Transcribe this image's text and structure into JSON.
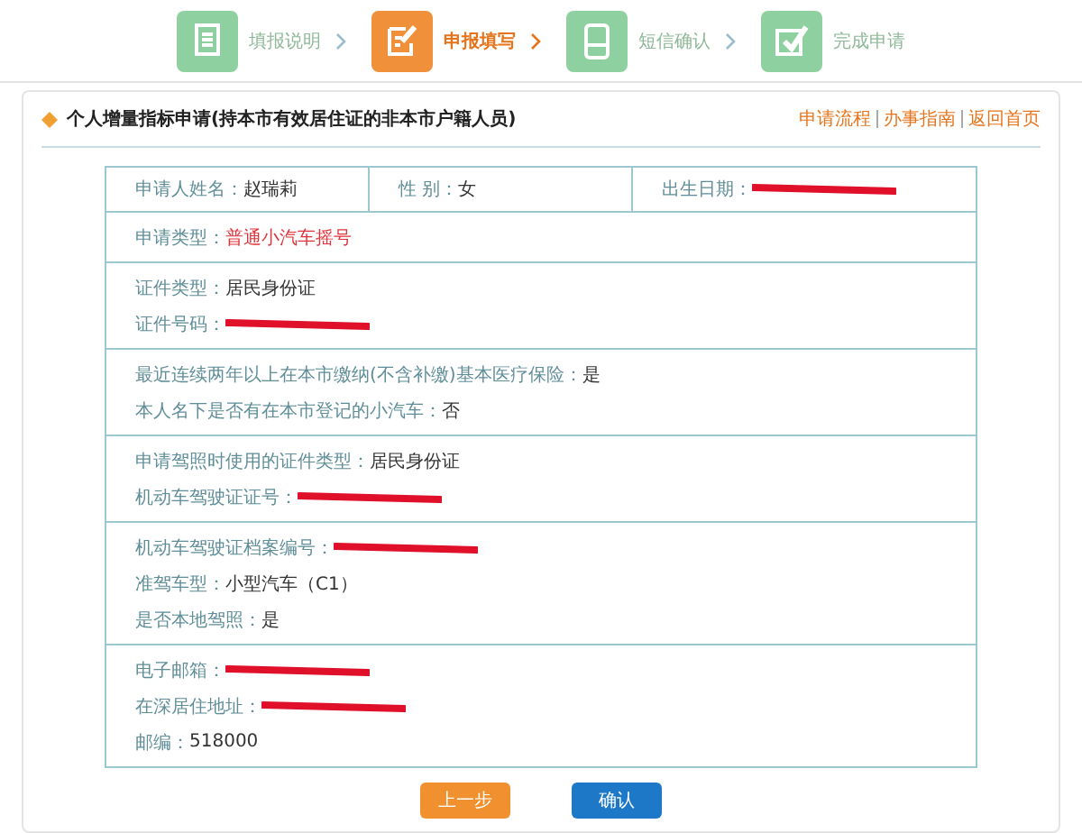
{
  "steps": [
    {
      "label": "填报说明",
      "kind": "document",
      "selected": false
    },
    {
      "label": "申报填写",
      "kind": "edit",
      "selected": true
    },
    {
      "label": "短信确认",
      "kind": "phone",
      "selected": false
    },
    {
      "label": "完成申请",
      "kind": "check",
      "selected": false
    }
  ],
  "title": "个人增量指标申请(持本市有效居住证的非本市户籍人员)",
  "links": [
    "申请流程",
    "办事指南",
    "返回首页"
  ],
  "header_row": [
    {
      "label": "申请人姓名：",
      "kind": "text",
      "value": "赵瑞莉"
    },
    {
      "label": "性 别：",
      "kind": "text",
      "value": "女"
    },
    {
      "label": "出生日期：",
      "kind": "redacted"
    }
  ],
  "sections": [
    [
      {
        "label": "申请类型：",
        "kind": "highlight",
        "value": "普通小汽车摇号"
      }
    ],
    [
      {
        "label": "证件类型：",
        "kind": "text",
        "value": "居民身份证"
      },
      {
        "label": "证件号码：",
        "kind": "redacted"
      }
    ],
    [
      {
        "label": "最近连续两年以上在本市缴纳(不含补缴)基本医疗保险：",
        "kind": "text",
        "value": "是"
      },
      {
        "label": "本人名下是否有在本市登记的小汽车：",
        "kind": "text",
        "value": "否"
      }
    ],
    [
      {
        "label": "申请驾照时使用的证件类型：",
        "kind": "text",
        "value": "居民身份证"
      },
      {
        "label": "机动车驾驶证证号：",
        "kind": "redacted"
      }
    ],
    [
      {
        "label": "机动车驾驶证档案编号：",
        "kind": "redacted"
      },
      {
        "label": "准驾车型：",
        "kind": "text",
        "value": "小型汽车（C1）"
      },
      {
        "label": "是否本地驾照：",
        "kind": "text",
        "value": "是"
      }
    ],
    [
      {
        "label": "电子邮箱：",
        "kind": "redacted"
      },
      {
        "label": "在深居住地址：",
        "kind": "redacted"
      },
      {
        "label": "邮编：",
        "kind": "text",
        "value": "518000"
      }
    ]
  ],
  "buttons": [
    {
      "label": "上一步",
      "kind": "secondary"
    },
    {
      "label": "确认",
      "kind": "primary"
    }
  ]
}
